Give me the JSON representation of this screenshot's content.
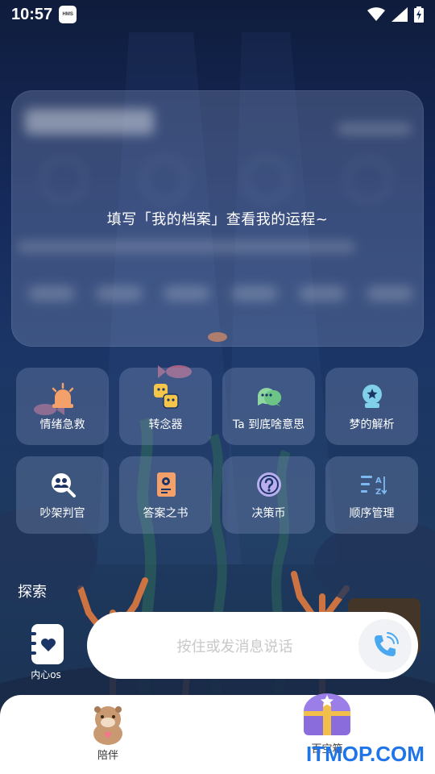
{
  "status_bar": {
    "time": "10:57",
    "badge": "HMS",
    "icons": [
      "wifi-icon",
      "signal-icon",
      "battery-charging-icon"
    ]
  },
  "fortune_card": {
    "prompt": "填写「我的档案」查看我的运程~"
  },
  "tools": [
    {
      "label": "情绪急救",
      "icon": "alarm-siren-icon"
    },
    {
      "label": "转念器",
      "icon": "faces-swap-icon"
    },
    {
      "label": "Ta 到底啥意思",
      "icon": "chat-bubbles-icon"
    },
    {
      "label": "梦的解析",
      "icon": "crystal-ball-icon"
    },
    {
      "label": "吵架判官",
      "icon": "people-search-icon"
    },
    {
      "label": "答案之书",
      "icon": "answer-book-icon"
    },
    {
      "label": "决策币",
      "icon": "question-coin-icon"
    },
    {
      "label": "顺序管理",
      "icon": "sort-az-icon"
    }
  ],
  "explore": {
    "title": "探索",
    "inner_os_label": "内心os"
  },
  "message_bar": {
    "placeholder": "按住或发消息说话"
  },
  "bottom_nav": {
    "companion_label": "陪伴",
    "treasure_label": "百宝箱"
  },
  "watermark": "ITMOP.COM",
  "colors": {
    "accent_blue": "#4aa8f0",
    "card_bg": "#8a9ec8",
    "watermark": "#1e74e8"
  }
}
